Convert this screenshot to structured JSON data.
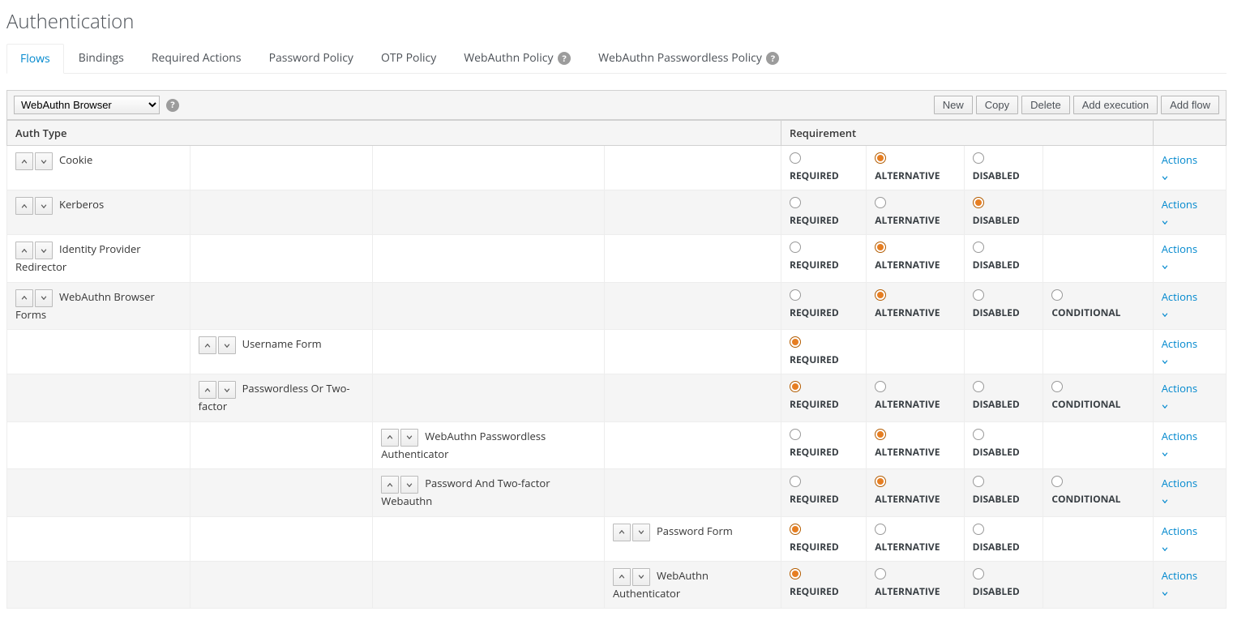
{
  "page": {
    "title": "Authentication"
  },
  "tabs": [
    {
      "label": "Flows",
      "active": true
    },
    {
      "label": "Bindings",
      "active": false
    },
    {
      "label": "Required Actions",
      "active": false
    },
    {
      "label": "Password Policy",
      "active": false
    },
    {
      "label": "OTP Policy",
      "active": false
    },
    {
      "label": "WebAuthn Policy",
      "active": false,
      "help": true
    },
    {
      "label": "WebAuthn Passwordless Policy",
      "active": false,
      "help": true
    }
  ],
  "toolbar": {
    "selected_flow": "WebAuthn Browser",
    "buttons": {
      "new": "New",
      "copy": "Copy",
      "delete": "Delete",
      "add_execution": "Add execution",
      "add_flow": "Add flow"
    }
  },
  "table": {
    "headers": {
      "auth_type": "Auth Type",
      "requirement": "Requirement"
    },
    "requirement_labels": {
      "required": "REQUIRED",
      "alternative": "ALTERNATIVE",
      "disabled": "DISABLED",
      "conditional": "CONDITIONAL"
    },
    "actions_label": "Actions",
    "rows": [
      {
        "name": "Cookie",
        "indent": 0,
        "req": {
          "required": false,
          "alternative": true,
          "disabled": false,
          "conditional": null
        }
      },
      {
        "name": "Kerberos",
        "indent": 0,
        "req": {
          "required": false,
          "alternative": false,
          "disabled": true,
          "conditional": null
        }
      },
      {
        "name": "Identity Provider Redirector",
        "indent": 0,
        "req": {
          "required": false,
          "alternative": true,
          "disabled": false,
          "conditional": null
        }
      },
      {
        "name": "WebAuthn Browser Forms",
        "indent": 0,
        "req": {
          "required": false,
          "alternative": true,
          "disabled": false,
          "conditional": false
        }
      },
      {
        "name": "Username Form",
        "indent": 1,
        "req": {
          "required": true,
          "alternative": null,
          "disabled": null,
          "conditional": null
        }
      },
      {
        "name": "Passwordless Or Two-factor",
        "indent": 1,
        "req": {
          "required": true,
          "alternative": false,
          "disabled": false,
          "conditional": false
        }
      },
      {
        "name": "WebAuthn Passwordless Authenticator",
        "indent": 2,
        "req": {
          "required": false,
          "alternative": true,
          "disabled": false,
          "conditional": null
        }
      },
      {
        "name": "Password And Two-factor Webauthn",
        "indent": 2,
        "req": {
          "required": false,
          "alternative": true,
          "disabled": false,
          "conditional": false
        }
      },
      {
        "name": "Password Form",
        "indent": 3,
        "req": {
          "required": true,
          "alternative": false,
          "disabled": false,
          "conditional": null
        }
      },
      {
        "name": "WebAuthn Authenticator",
        "indent": 3,
        "req": {
          "required": true,
          "alternative": false,
          "disabled": false,
          "conditional": null
        }
      }
    ]
  }
}
